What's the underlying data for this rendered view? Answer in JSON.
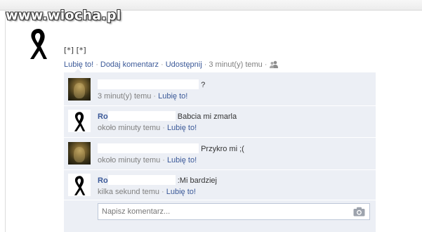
{
  "watermark": {
    "text": "www.wiocha.pl"
  },
  "post": {
    "avatar_icon": "black-ribbon-icon",
    "text": "[*] [*]",
    "actions": {
      "like": "Lubię to!",
      "comment": "Dodaj komentarz",
      "share": "Udostępnij",
      "time": "3 minut(y) temu",
      "audience_icon": "friends-icon"
    }
  },
  "comments": [
    {
      "author": "",
      "text": "?",
      "time": "3 minut(y) temu",
      "like": "Lubię to!",
      "avatar_icon": "profile-photo"
    },
    {
      "author": "Ro",
      "text": "Babcia mi zmarla",
      "time": "około minuty temu",
      "like": "Lubię to!",
      "avatar_icon": "black-ribbon-icon"
    },
    {
      "author": "",
      "text": "Przykro mi ;(",
      "time": "około minuty temu",
      "like": "Lubię to!",
      "avatar_icon": "profile-photo"
    },
    {
      "author": "Ro",
      "text": ":Mi bardziej",
      "time": "kilka sekund temu",
      "like": "Lubię to!",
      "avatar_icon": "black-ribbon-icon"
    }
  ],
  "composer": {
    "placeholder": "Napisz komentarz...",
    "camera_icon": "camera-icon"
  },
  "colors": {
    "link": "#3b5998",
    "comment_bg": "#eceff5",
    "meta_text": "#808080",
    "input_border": "#bdc7d8"
  }
}
